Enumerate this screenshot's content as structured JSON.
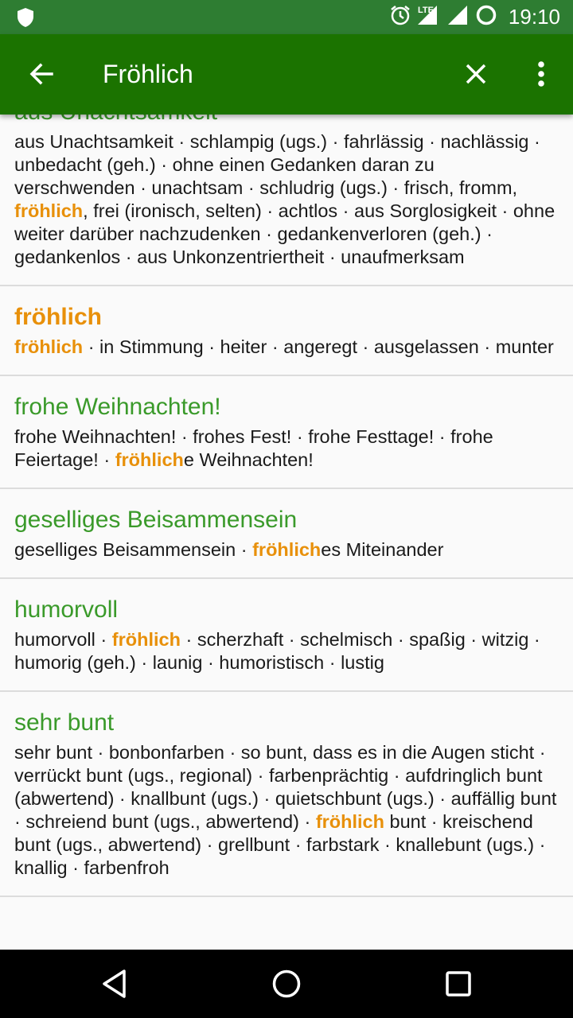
{
  "status_bar": {
    "time": "19:10",
    "network": "LTE",
    "icons": [
      "shield-icon",
      "alarm-icon",
      "lte-signal-icon",
      "signal-icon",
      "sync-icon"
    ]
  },
  "toolbar": {
    "title": "Fröhlich",
    "icons": [
      "back-arrow-icon",
      "close-icon",
      "more-vert-icon"
    ]
  },
  "colors": {
    "status_bar": "#2e7d32",
    "toolbar": "#1b7300",
    "entry_title": "#3a9a2a",
    "highlight": "#e8900a",
    "text": "#1a1a1a",
    "background": "#fafafa",
    "divider": "#dcdcdc"
  },
  "entries": [
    {
      "title": "aus Unachtsamkeit",
      "text": [
        {
          "t": "aus Unachtsamkeit · schlampig (ugs.) · fahrlässig · nach­lässig · unbedacht (geh.) · ohne einen Gedanken daran zu verschwenden · unachtsam · schludrig (ugs.) · frisch, fromm, ",
          "hl": false
        },
        {
          "t": "fröhlich",
          "hl": true
        },
        {
          "t": ", frei (ironisch, selten) · achtlos · aus Sorglosigkeit · ohne weiter darüber nachzudenken · gedankenverloren (geh.) · gedankenlos · aus Unkonzentriertheit · unaufmerksam",
          "hl": false
        }
      ]
    },
    {
      "title": "fröhlich",
      "title_highlight": true,
      "text": [
        {
          "t": "fröhlich",
          "hl": true
        },
        {
          "t": " · in Stimmung · heiter · angeregt · ausgelassen · munter",
          "hl": false
        }
      ]
    },
    {
      "title": "frohe Weihnachten!",
      "text": [
        {
          "t": "frohe Weihnachten! · frohes Fest! · frohe Festtage! · frohe Feiertage! · ",
          "hl": false
        },
        {
          "t": "fröhlich",
          "hl": true
        },
        {
          "t": "e Weihnachten!",
          "hl": false
        }
      ]
    },
    {
      "title": "geselliges Beisammensein",
      "text": [
        {
          "t": "geselliges Beisammensein · ",
          "hl": false
        },
        {
          "t": "fröhlich",
          "hl": true
        },
        {
          "t": "es Miteinander",
          "hl": false
        }
      ]
    },
    {
      "title": "humorvoll",
      "text": [
        {
          "t": "humorvoll · ",
          "hl": false
        },
        {
          "t": "fröhlich",
          "hl": true
        },
        {
          "t": " · scherzhaft · schelmisch · spaßig · witzig · humorig (geh.) · launig · humoristisch · lustig",
          "hl": false
        }
      ]
    },
    {
      "title": "sehr bunt",
      "text": [
        {
          "t": "sehr bunt · bonbonfarben · so bunt, dass es in die Augen sticht · verrückt bunt (ugs., regional) · farbenprächtig · auf­dringlich bunt (abwertend) · knallbunt (ugs.) · quietschbunt (ugs.) · auffällig bunt · schreiend bunt (ugs., abwertend) · ",
          "hl": false
        },
        {
          "t": "fröhlich",
          "hl": true
        },
        {
          "t": " bunt · kreischend bunt (ugs., abwertend) · grellbunt · farbstark · knallebunt (ugs.) · knallig · farbenfroh",
          "hl": false
        }
      ]
    }
  ],
  "nav_bar": {
    "icons": [
      "back-triangle-icon",
      "home-circle-icon",
      "recents-square-icon"
    ]
  }
}
